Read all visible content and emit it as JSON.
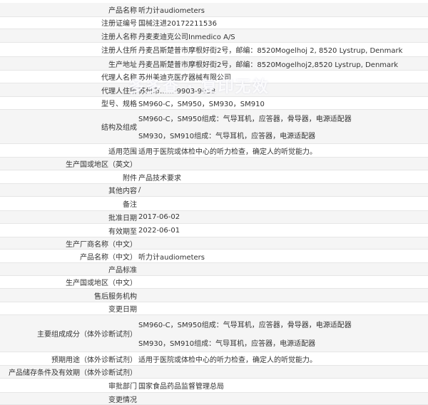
{
  "rows": [
    {
      "label": "产品名称",
      "value": "听力计audiometers"
    },
    {
      "label": "注册证编号",
      "value": "国械注进20172211536"
    },
    {
      "label": "注册人名称",
      "value": "丹麦麦迪克公司Inmedico A/S"
    },
    {
      "label": "注册人住所",
      "value": "丹麦吕斯楚普市摩根好街2号，邮编：8520Mogelhoj 2, 8520 Lystrup, Denmark"
    },
    {
      "label": "生产地址",
      "value": "丹麦吕斯楚普市摩根好街2号，邮编：8520Mogelhoj2,8520 Lystrup, Denmark"
    },
    {
      "label": "代理人名称",
      "value": "苏州美迪克医疗器械有限公司"
    },
    {
      "label": "代理人住所",
      "value": "苏州市……-9903-9058"
    },
    {
      "label": "型号、规格",
      "value": "SM960-C，SM950，SM930，SM910"
    },
    {
      "label": "结构及组成",
      "lines": [
        "SM960-C，SM950组成：气导耳机，应答器，骨导器，电源适配器",
        "SM930，SM910组成：气导耳机，应答器，电源适配器"
      ]
    },
    {
      "label": "适用范围",
      "value": "适用于医院或体检中心的听力检查，确定人的听觉能力。"
    },
    {
      "label": "生产国或地区（英文）",
      "value": ""
    },
    {
      "label": "附件",
      "value": "产品技术要求"
    },
    {
      "label": "其他内容",
      "value": "/"
    },
    {
      "label": "备注",
      "value": ""
    },
    {
      "label": "批准日期",
      "value": "2017-06-02"
    },
    {
      "label": "有效期至",
      "value": "2022-06-01"
    },
    {
      "label": "生产厂商名称（中文）",
      "value": ""
    },
    {
      "label": "产品名称（中文）",
      "value": "听力计audiometers"
    },
    {
      "label": "产品标准",
      "value": ""
    },
    {
      "label": "生产国或地区（中文）",
      "value": ""
    },
    {
      "label": "售后服务机构",
      "value": ""
    },
    {
      "label": "变更日期",
      "value": ""
    },
    {
      "label": "主要组成成分（体外诊断试剂）",
      "lines": [
        "SM960-C，SM950组成：气导耳机，应答器，骨导器，电源适配器",
        "SM930，SM910组成：气导耳机，应答器，电源适配器"
      ]
    },
    {
      "label": "预期用途（体外诊断试剂）",
      "value": "适用于医院或体检中心的听力检查，确定人的听觉能力。"
    },
    {
      "label": "产品储存条件及有效期（体外诊断试剂）",
      "value": ""
    },
    {
      "label": "审批部门",
      "value": "国家食品药品监督管理总局"
    },
    {
      "label": "变更情况",
      "value": ""
    }
  ],
  "watermark": "多多查 · 复印无效"
}
